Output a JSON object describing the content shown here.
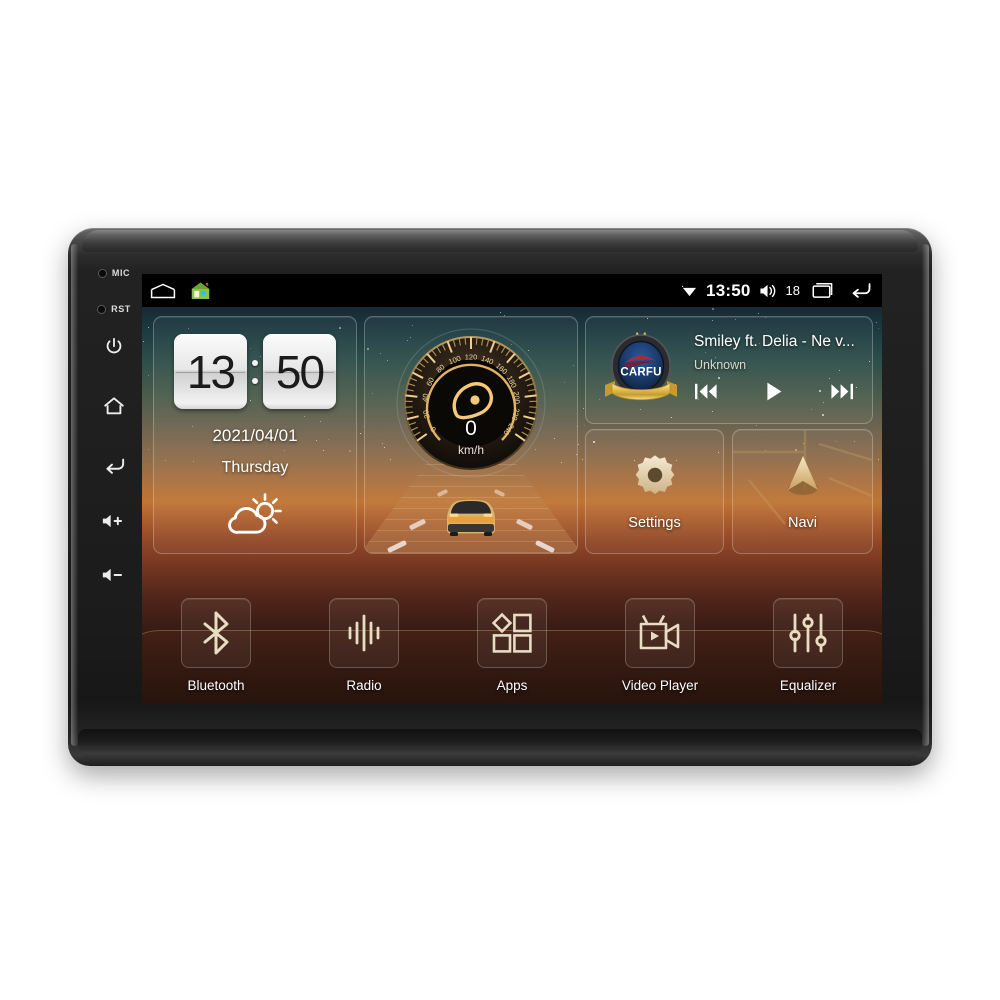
{
  "device": {
    "name": "car-head-unit",
    "bezel_buttons": [
      {
        "name": "mic-pinhole",
        "label": "MIC",
        "icon": "pinhole"
      },
      {
        "name": "reset-pinhole",
        "label": "RST",
        "icon": "pinhole"
      },
      {
        "name": "power-button",
        "label": "",
        "icon": "power-icon"
      },
      {
        "name": "home-button",
        "label": "",
        "icon": "home-icon"
      },
      {
        "name": "back-button",
        "label": "",
        "icon": "back-arrow-icon"
      },
      {
        "name": "volume-up-button",
        "label": "",
        "icon": "volume-up-icon"
      },
      {
        "name": "volume-down-button",
        "label": "",
        "icon": "volume-down-icon"
      }
    ]
  },
  "statusbar": {
    "left_icons": [
      {
        "name": "carport-icon",
        "label": "carport"
      },
      {
        "name": "house-app-icon",
        "label": "house"
      }
    ],
    "wifi_icon": "wifi-icon",
    "clock": "13:50",
    "volume_icon": "volume-icon",
    "volume_value": "18",
    "recents_icon": "recent-apps-icon",
    "back_icon": "back-arrow-icon"
  },
  "clock_widget": {
    "hours": "13",
    "minutes": "50",
    "separator": ":",
    "date": "2021/04/01",
    "weekday": "Thursday",
    "weather_icon": "partly-cloudy-sun-icon"
  },
  "speedometer_widget": {
    "value": "0",
    "unit": "km/h",
    "ticks": [
      "0",
      "20",
      "40",
      "60",
      "80",
      "100",
      "120",
      "140",
      "160",
      "180",
      "200",
      "220",
      "240"
    ],
    "min": 0,
    "max": 240,
    "car_illustration": "car-on-road-illustration"
  },
  "music_widget": {
    "album_art": "carfu-badge-logo",
    "album_art_text": "CARFU",
    "title": "Smiley ft. Delia - Ne v...",
    "artist": "Unknown",
    "controls": [
      {
        "name": "previous-track-button",
        "icon": "skip-previous-icon"
      },
      {
        "name": "play-button",
        "icon": "play-icon"
      },
      {
        "name": "next-track-button",
        "icon": "skip-next-icon"
      }
    ]
  },
  "tiles": [
    {
      "name": "settings-tile",
      "label": "Settings",
      "icon": "gear-icon"
    },
    {
      "name": "navi-tile",
      "label": "Navi",
      "icon": "navigation-arrow-icon"
    }
  ],
  "dock": [
    {
      "name": "dock-bluetooth",
      "label": "Bluetooth",
      "icon": "bluetooth-icon"
    },
    {
      "name": "dock-radio",
      "label": "Radio",
      "icon": "radio-waveform-icon"
    },
    {
      "name": "dock-apps",
      "label": "Apps",
      "icon": "apps-grid-icon"
    },
    {
      "name": "dock-video-player",
      "label": "Video Player",
      "icon": "video-camera-icon"
    },
    {
      "name": "dock-equalizer",
      "label": "Equalizer",
      "icon": "equalizer-sliders-icon"
    }
  ],
  "colors": {
    "accent_gold": "#e0c089",
    "status_bar_bg": "#000000",
    "badge_navy": "#16305c",
    "badge_gold": "#e9c24f",
    "badge_car_red": "#b0273a",
    "sunset_orange": "#c07434"
  }
}
